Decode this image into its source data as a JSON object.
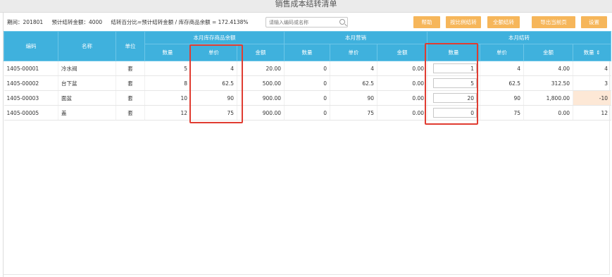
{
  "window": {
    "title": "销售成本结转清单"
  },
  "toolbar": {
    "period": "期间：201801",
    "estimated_amount": "预计结转金额：4000",
    "percentage": "结转百分比=预计结转金额 / 库存商品余额 = 172.4138%",
    "search_placeholder": "请输入编码或名称",
    "buttons": [
      "帮助",
      "按比例结转",
      "全额结转",
      "导出当前页",
      "设置"
    ]
  },
  "table": {
    "group_headers": [
      "本月库存商品余额",
      "本月营销",
      "本月结转"
    ],
    "base_headers": [
      "编码",
      "名称",
      "单位"
    ],
    "sub_headers": [
      "数量",
      "单价",
      "金额",
      "数量",
      "单价",
      "金额",
      "数量",
      "单价",
      "金额",
      "数量 ⇕"
    ],
    "rows": [
      {
        "code": "1405-00001",
        "name": "冷水阀",
        "unit": "套",
        "s_qty": "5",
        "s_price": "4",
        "s_amt": "20.00",
        "m_qty": "0",
        "m_price": "4",
        "m_amt": "0.00",
        "c_qty": "1",
        "c_price": "4",
        "c_amt": "4.00",
        "r_qty": "4"
      },
      {
        "code": "1405-00002",
        "name": "台下盆",
        "unit": "套",
        "s_qty": "8",
        "s_price": "62.5",
        "s_amt": "500.00",
        "m_qty": "0",
        "m_price": "62.5",
        "m_amt": "0.00",
        "c_qty": "5",
        "c_price": "62.5",
        "c_amt": "312.50",
        "r_qty": "3"
      },
      {
        "code": "1405-00003",
        "name": "面盆",
        "unit": "套",
        "s_qty": "10",
        "s_price": "90",
        "s_amt": "900.00",
        "m_qty": "0",
        "m_price": "90",
        "m_amt": "0.00",
        "c_qty": "20",
        "c_price": "90",
        "c_amt": "1,800.00",
        "r_qty": "-10"
      },
      {
        "code": "1405-00005",
        "name": "盖",
        "unit": "套",
        "s_qty": "12",
        "s_price": "75",
        "s_amt": "900.00",
        "m_qty": "0",
        "m_price": "75",
        "m_amt": "0.00",
        "c_qty": "0",
        "c_price": "75",
        "c_amt": "0.00",
        "r_qty": "12"
      }
    ]
  },
  "colors": {
    "header_bg": "#3fb1dd",
    "button_bg": "#f6b65a",
    "highlight": "#e03c31",
    "negative_bg": "#fde8d6"
  }
}
